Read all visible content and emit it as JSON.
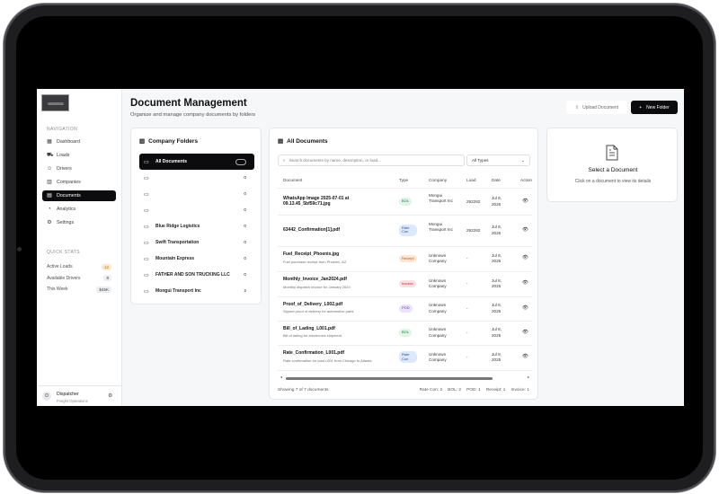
{
  "sidebar": {
    "nav_title": "NAVIGATION",
    "items": [
      {
        "label": "Dashboard",
        "icon": "grid-icon",
        "glyph": "▦"
      },
      {
        "label": "Loads",
        "icon": "truck-icon",
        "glyph": "⛟"
      },
      {
        "label": "Drivers",
        "icon": "users-icon",
        "glyph": "☺"
      },
      {
        "label": "Companies",
        "icon": "building-icon",
        "glyph": "▥"
      },
      {
        "label": "Documents",
        "icon": "document-icon",
        "glyph": "▤"
      },
      {
        "label": "Analytics",
        "icon": "chart-icon",
        "glyph": "◔"
      },
      {
        "label": "Settings",
        "icon": "gear-icon",
        "glyph": "⚙"
      }
    ],
    "active_index": 4,
    "quick_stats_title": "QUICK STATS",
    "quick_stats": [
      {
        "label": "Active Loads",
        "value": "12"
      },
      {
        "label": "Available Drivers",
        "value": "8"
      },
      {
        "label": "This Week",
        "value": "$45K"
      }
    ],
    "user": {
      "initial": "D",
      "name": "Dispatcher",
      "role": "Freight Operations"
    }
  },
  "header": {
    "title": "Document Management",
    "subtitle": "Organize and manage company documents by folders",
    "upload_label": "Upload Document",
    "new_folder_label": "New Folder"
  },
  "folders": {
    "title": "Company Folders",
    "items": [
      {
        "name": "All Documents",
        "count": ""
      },
      {
        "name": "",
        "count": "0"
      },
      {
        "name": "",
        "count": "0"
      },
      {
        "name": "",
        "count": "0"
      },
      {
        "name": "Blue Ridge Logistics",
        "count": "0"
      },
      {
        "name": "Swift Transportation",
        "count": "0"
      },
      {
        "name": "Mountain Express",
        "count": "0"
      },
      {
        "name": "FATHER AND SON TRUCKING LLC",
        "count": "0"
      },
      {
        "name": "Mongui Transport Inc",
        "count": "2"
      }
    ]
  },
  "documents": {
    "title": "All Documents",
    "search_placeholder": "Search documents by name, description, or load...",
    "type_filter": "All Types",
    "columns": [
      "Document",
      "Type",
      "Company",
      "Load",
      "Date",
      "Actions"
    ],
    "rows": [
      {
        "name": "WhatsApp Image 2025-07-01 at 09.13.45_5bf59c71.jpg",
        "desc": "",
        "type": "BOL",
        "type_class": "bol",
        "company": "Mongui Transport Inc",
        "load": "292282",
        "date": "Jul 8, 2025"
      },
      {
        "name": "63442_Confirmation[1].pdf",
        "desc": "",
        "type": "Rate Con",
        "type_class": "rate",
        "company": "Mongui Transport Inc",
        "load": "292282",
        "date": "Jul 8, 2025"
      },
      {
        "name": "Fuel_Receipt_Phoenix.jpg",
        "desc": "Fuel purchase receipt from Phoenix, AZ",
        "type": "Receipt",
        "type_class": "receipt",
        "company": "Unknown Company",
        "load": "-",
        "date": "Jul 8, 2025"
      },
      {
        "name": "Monthly_Invoice_Jan2024.pdf",
        "desc": "Monthly dispatch invoice for January 2024",
        "type": "Invoice",
        "type_class": "invoice",
        "company": "Unknown Company",
        "load": "-",
        "date": "Jul 8, 2025"
      },
      {
        "name": "Proof_of_Delivery_L002.pdf",
        "desc": "Signed proof of delivery for automotive parts",
        "type": "POD",
        "type_class": "pod",
        "company": "Unknown Company",
        "load": "-",
        "date": "Jul 8, 2025"
      },
      {
        "name": "Bill_of_Lading_L001.pdf",
        "desc": "Bill of lading for electronics shipment",
        "type": "BOL",
        "type_class": "bol",
        "company": "Unknown Company",
        "load": "-",
        "date": "Jul 8, 2025"
      },
      {
        "name": "Rate_Confirmation_L001.pdf",
        "desc": "Rate confirmation for load L001 from Chicago to Atlanta",
        "type": "Rate Con",
        "type_class": "rate",
        "company": "Unknown Company",
        "load": "-",
        "date": "Jul 8, 2025"
      }
    ],
    "footer_count": "Showing 7 of 7 documents",
    "footer_stats": [
      "Rate Con: 2",
      "BOL: 2",
      "POD: 1",
      "Receipt: 1",
      "Invoice: 1"
    ]
  },
  "preview": {
    "title": "Select a Document",
    "subtitle": "Click on a document to view its details"
  }
}
